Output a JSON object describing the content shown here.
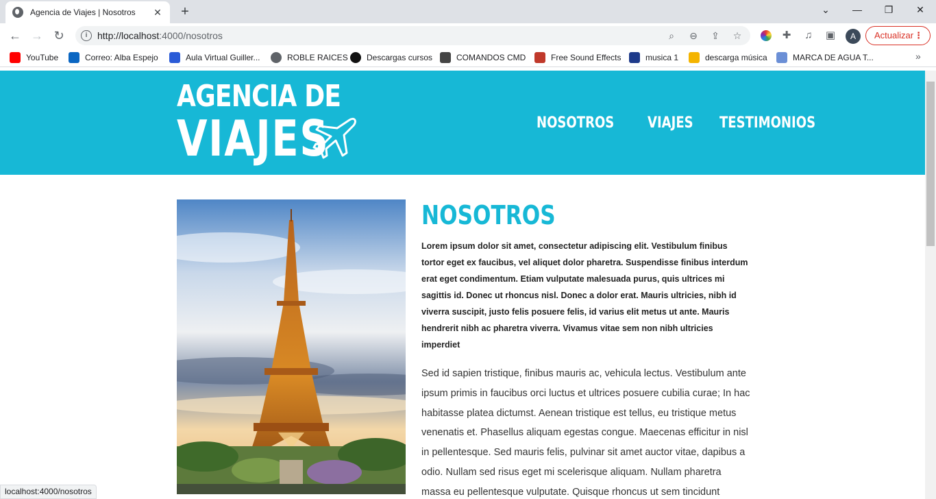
{
  "browser": {
    "tab_title": "Agencia de Viajes | Nosotros",
    "new_tab": "+",
    "url_host": "http://localhost",
    "url_rest": ":4000/nosotros",
    "profile_initial": "A",
    "update_label": "Actualizar",
    "status_url": "localhost:4000/nosotros"
  },
  "bookmarks": [
    {
      "label": "YouTube",
      "color": "#ff0000"
    },
    {
      "label": "Correo: Alba Espejo",
      "color": "#0a66c2"
    },
    {
      "label": "Aula Virtual Guiller...",
      "color": "#2a5bd7"
    },
    {
      "label": "ROBLE RAICES",
      "color": "#5f6368"
    },
    {
      "label": "Descargas cursos",
      "color": "#111111"
    },
    {
      "label": "COMANDOS CMD",
      "color": "#444444"
    },
    {
      "label": "Free Sound Effects",
      "color": "#c0392b"
    },
    {
      "label": "musica 1",
      "color": "#1e3a8a"
    },
    {
      "label": "descarga música",
      "color": "#f4b400"
    },
    {
      "label": "MARCA DE AGUA T...",
      "color": "#6b8fd6"
    }
  ],
  "site": {
    "logo_line1": "AGENCIA DE",
    "logo_line2": "VIAJES",
    "nav": [
      "NOSOTROS",
      "VIAJES",
      "TESTIMONIOS"
    ],
    "brand_color": "#17b8d6",
    "heading": "NOSOTROS",
    "lead": "Lorem ipsum dolor sit amet, consectetur adipiscing elit. Vestibulum finibus tortor eget ex faucibus, vel aliquet dolor pharetra. Suspendisse finibus interdum erat eget condimentum. Etiam vulputate malesuada purus, quis ultrices mi sagittis id. Donec ut rhoncus nisl. Donec a dolor erat. Mauris ultricies, nibh id viverra suscipit, justo felis posuere felis, id varius elit metus ut ante. Mauris hendrerit nibh ac pharetra viverra. Vivamus vitae sem non nibh ultricies imperdiet",
    "body": "Sed id sapien tristique, finibus mauris ac, vehicula lectus. Vestibulum ante ipsum primis in faucibus orci luctus et ultrices posuere cubilia curae; In hac habitasse platea dictumst. Aenean tristique est tellus, eu tristique metus venenatis et. Phasellus aliquam egestas congue. Maecenas efficitur in nisl in pellentesque. Sed mauris felis, pulvinar sit amet auctor vitae, dapibus a odio. Nullam sed risus eget mi scelerisque aliquam. Nullam pharetra massa eu pellentesque vulputate. Quisque rhoncus ut sem tincidunt tempor. Lorem ipsum dolor sit amet, consectetur adipiscing elit. Fusce"
  }
}
